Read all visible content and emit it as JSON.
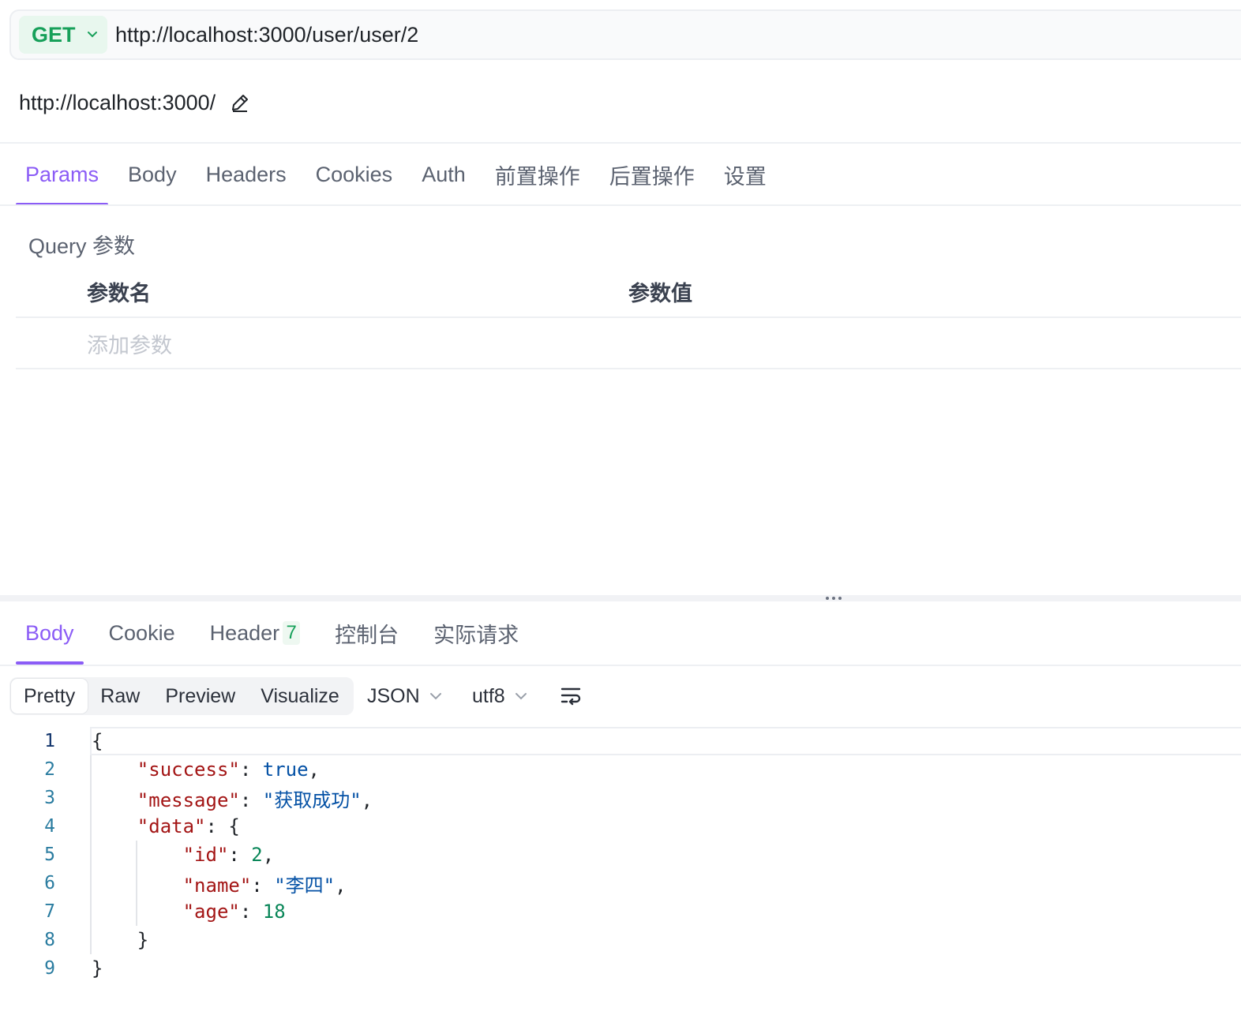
{
  "request": {
    "method": "GET",
    "url": "http://localhost:3000/user/user/2",
    "base_url": "http://localhost:3000/"
  },
  "request_tabs": [
    {
      "label": "Params",
      "active": true
    },
    {
      "label": "Body"
    },
    {
      "label": "Headers"
    },
    {
      "label": "Cookies"
    },
    {
      "label": "Auth"
    },
    {
      "label": "前置操作"
    },
    {
      "label": "后置操作"
    },
    {
      "label": "设置"
    }
  ],
  "query": {
    "title": "Query 参数",
    "col_name": "参数名",
    "col_value": "参数值",
    "add_placeholder": "添加参数"
  },
  "response_tabs": [
    {
      "label": "Body",
      "active": true
    },
    {
      "label": "Cookie"
    },
    {
      "label": "Header",
      "badge": "7"
    },
    {
      "label": "控制台"
    },
    {
      "label": "实际请求"
    }
  ],
  "view_modes": [
    "Pretty",
    "Raw",
    "Preview",
    "Visualize"
  ],
  "active_view": "Pretty",
  "format": "JSON",
  "encoding": "utf8",
  "code": {
    "line_numbers": [
      "1",
      "2",
      "3",
      "4",
      "5",
      "6",
      "7",
      "8",
      "9"
    ],
    "punct": {
      "open": "{",
      "close": "}",
      "colon": ": ",
      "comma": ","
    },
    "success_key": "\"success\"",
    "success_val": "true",
    "message_key": "\"message\"",
    "message_val": "\"获取成功\"",
    "data_key": "\"data\"",
    "id_key": "\"id\"",
    "id_val": "2",
    "name_key": "\"name\"",
    "name_val": "\"李四\"",
    "age_key": "\"age\"",
    "age_val": "18"
  },
  "colors": {
    "accent": "#8b5cf6",
    "method_green": "#17a05a",
    "json_key": "#a31515",
    "json_string": "#0451a5",
    "json_number": "#098658"
  }
}
